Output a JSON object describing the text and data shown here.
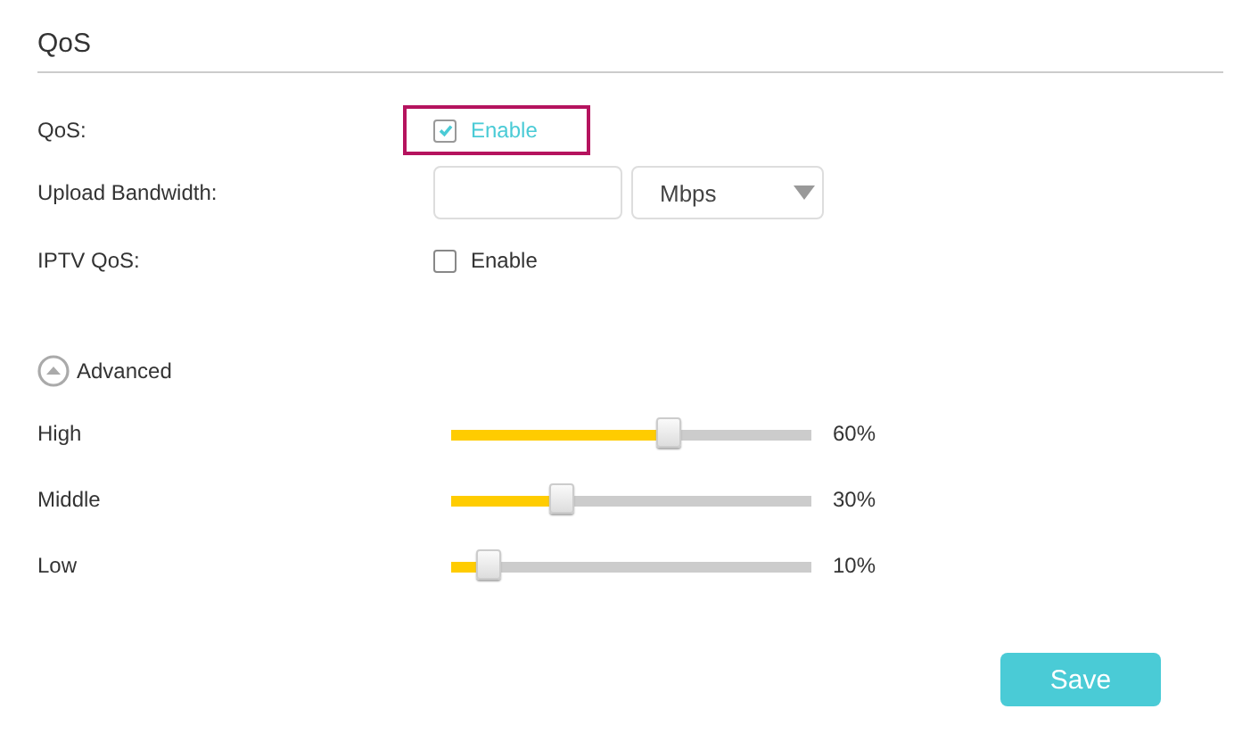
{
  "section_title": "QoS",
  "rows": [
    {
      "kind": "checkbox",
      "label": "QoS:",
      "option": "Enable",
      "checked": true,
      "highlighted": true
    },
    {
      "kind": "bandwidth",
      "label": "Upload Bandwidth:",
      "unit": "Mbps"
    },
    {
      "kind": "checkbox",
      "label": "IPTV QoS:",
      "option": "Enable",
      "checked": false,
      "highlighted": false
    }
  ],
  "advanced": {
    "label": "Advanced",
    "expanded": true
  },
  "priorities": [
    {
      "name": "High",
      "level": 0.6,
      "reading": "60%"
    },
    {
      "name": "Middle",
      "level": 0.3,
      "reading": "30%"
    },
    {
      "name": "Low",
      "level": 0.1,
      "reading": "10%"
    }
  ],
  "save_button": "Save"
}
